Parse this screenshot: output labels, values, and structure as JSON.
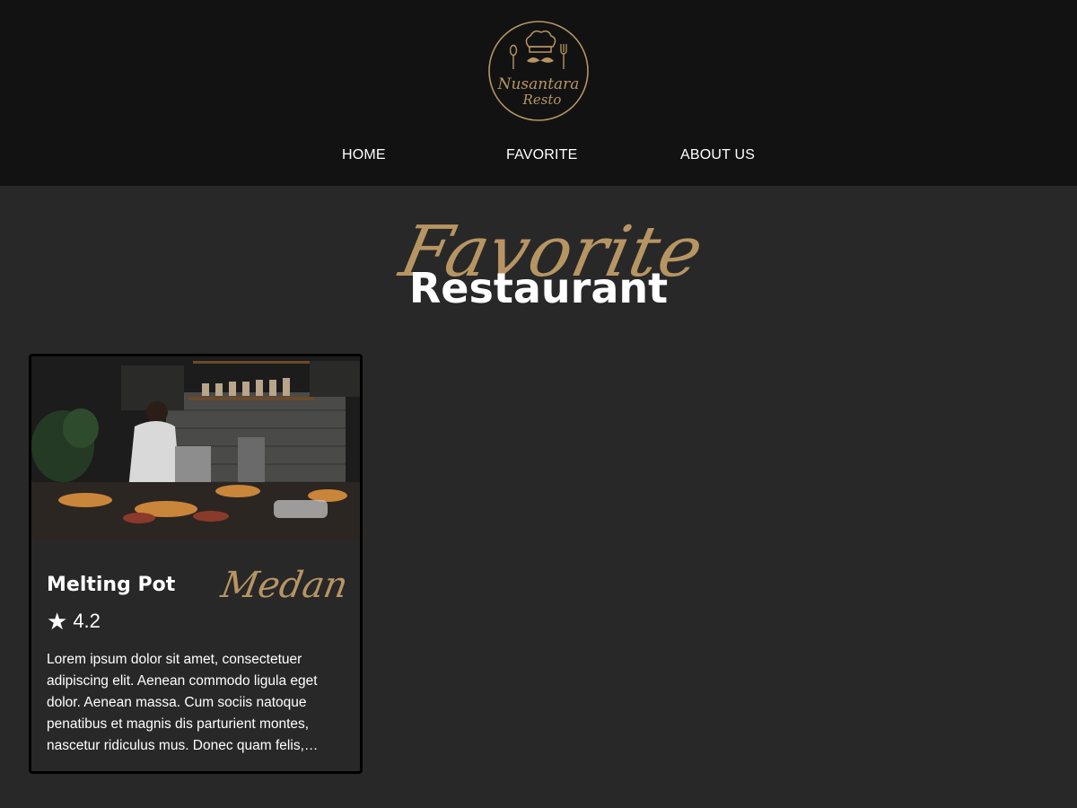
{
  "brand": {
    "logo_lines": [
      "Nusantara",
      "Resto"
    ],
    "accent_color": "#b79563"
  },
  "nav": {
    "items": [
      {
        "label": "HOME"
      },
      {
        "label": "FAVORITE"
      },
      {
        "label": "ABOUT US"
      }
    ]
  },
  "hero": {
    "script_title": "Favorite",
    "main_title": "Restaurant"
  },
  "restaurants": [
    {
      "name": "Melting Pot",
      "city": "Medan",
      "rating_icon": "star-icon",
      "rating": "4.2",
      "description": "Lorem ipsum dolor sit amet, consectetuer adipiscing elit. Aenean commodo ligula eget dolor. Aenean massa. Cum sociis natoque penatibus et magnis dis parturient montes, nascetur ridiculus mus. Donec quam felis,…"
    }
  ]
}
